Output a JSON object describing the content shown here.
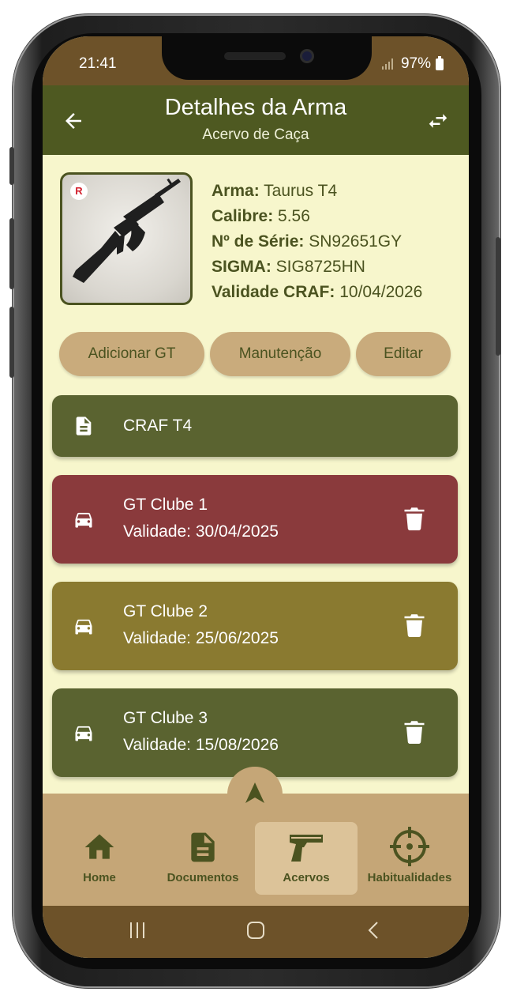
{
  "status_bar": {
    "time": "21:41",
    "battery": "97%"
  },
  "app_bar": {
    "title": "Detalhes da Arma",
    "subtitle": "Acervo de Caça"
  },
  "weapon": {
    "badge": "R",
    "fields": [
      {
        "label": "Arma:",
        "value": "Taurus T4"
      },
      {
        "label": "Calibre:",
        "value": "5.56"
      },
      {
        "label": "Nº de Série:",
        "value": "SN92651GY"
      },
      {
        "label": "SIGMA:",
        "value": "SIG8725HN"
      },
      {
        "label": "Validade CRAF:",
        "value": "10/04/2026"
      }
    ]
  },
  "actions": {
    "add_gt": "Adicionar GT",
    "maintenance": "Manutenção",
    "edit": "Editar"
  },
  "cards": [
    {
      "title": "CRAF T4",
      "icon": "document-icon",
      "color": "#5a6330"
    },
    {
      "title": "GT Clube 1",
      "validity": "Validade: 30/04/2025",
      "icon": "car-icon",
      "color": "#8a3a3c"
    },
    {
      "title": "GT Clube 2",
      "validity": "Validade: 25/06/2025",
      "icon": "car-icon",
      "color": "#8a7a30"
    },
    {
      "title": "GT Clube 3",
      "validity": "Validade: 15/08/2026",
      "icon": "car-icon",
      "color": "#5a6330"
    }
  ],
  "bottom_nav": {
    "items": [
      {
        "label": "Home",
        "icon": "home-icon"
      },
      {
        "label": "Documentos",
        "icon": "document-icon"
      },
      {
        "label": "Acervos",
        "icon": "pistol-icon",
        "active": true
      },
      {
        "label": "Habitualidades",
        "icon": "crosshair-icon"
      }
    ]
  },
  "colors": {
    "primary": "#4e5921",
    "accent": "#c9ab7c",
    "background": "#f7f6cc",
    "status_bar": "#6d5229"
  }
}
